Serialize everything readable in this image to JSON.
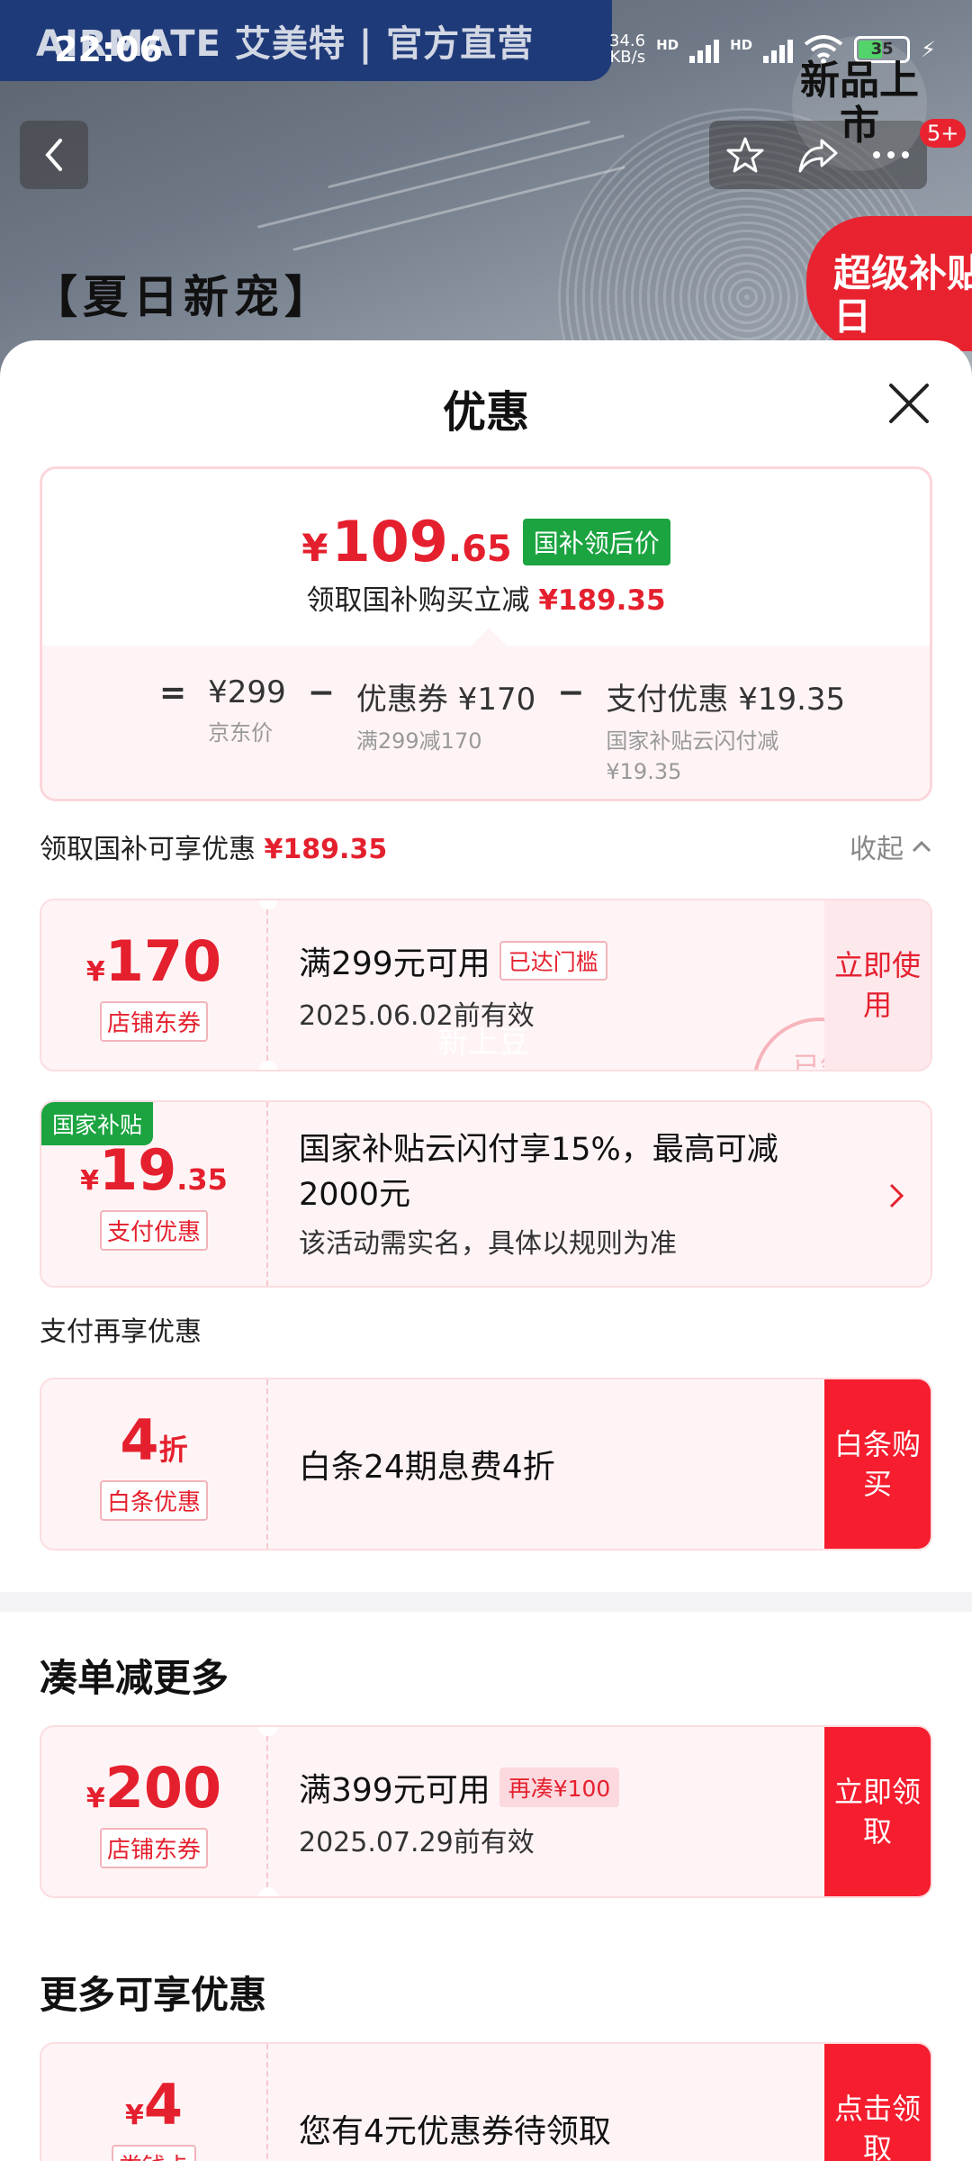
{
  "status": {
    "time": "22:06",
    "net_speed_value": "34.6",
    "net_speed_unit": "KB/s",
    "hd1": "HD",
    "hd2": "HD",
    "battery": "35"
  },
  "background": {
    "brand": "AIRMATE 艾美特 | 官方直营",
    "new_badge": "新品上市",
    "badge_count": "5+",
    "promo_title": "【夏日新宠】",
    "subsidy_day": "超级补贴日"
  },
  "sheet": {
    "title": "优惠",
    "summary": {
      "price_symbol": "¥",
      "price_int": "109",
      "price_dec": ".65",
      "price_tag": "国补领后价",
      "sub_text": "领取国补购买立减",
      "sub_amount": "¥189.35",
      "eq": "=",
      "base_price": "¥299",
      "base_label": "京东价",
      "minus1": "−",
      "coupon_main": "优惠券 ¥170",
      "coupon_sub": "满299减170",
      "minus2": "−",
      "pay_main": "支付优惠 ¥19.35",
      "pay_sub": "国家补贴云闪付减 ¥19.35"
    },
    "claim_row": {
      "label": "领取国补可享优惠",
      "amount": "¥189.35",
      "collapse": "收起"
    },
    "coupon1": {
      "yen": "¥",
      "amount": "170",
      "tag": "店铺东券",
      "condition": "满299元可用",
      "badge": "已达门槛",
      "date": "2025.06.02前有效",
      "action": "立即使用",
      "stamp": "已领",
      "ghost": "新上豆"
    },
    "coupon2": {
      "corner_tag": "国家补贴",
      "yen": "¥",
      "amount": "19",
      "decimal": ".35",
      "tag": "支付优惠",
      "desc": "国家补贴云闪付享15%，最高可减2000元",
      "note": "该活动需实名，具体以规则为准"
    },
    "pay_section_label": "支付再享优惠",
    "coupon3": {
      "amount": "4",
      "unit": "折",
      "tag": "白条优惠",
      "desc": "白条24期息费4折",
      "action": "白条购买"
    },
    "section2_title": "凑单减更多",
    "coupon4": {
      "yen": "¥",
      "amount": "200",
      "tag": "店铺东券",
      "condition": "满399元可用",
      "badge": "再凑¥100",
      "date": "2025.07.29前有效",
      "action": "立即领取"
    },
    "section3_title": "更多可享优惠",
    "coupon5": {
      "yen": "¥",
      "amount": "4",
      "tag": "类钱卡",
      "desc": "您有4元优惠券待领取",
      "action": "点击领取"
    }
  },
  "colors": {
    "accent_red": "#e5202e",
    "subsidy_green": "#1ba440",
    "card_bg": "#fff4f5"
  }
}
